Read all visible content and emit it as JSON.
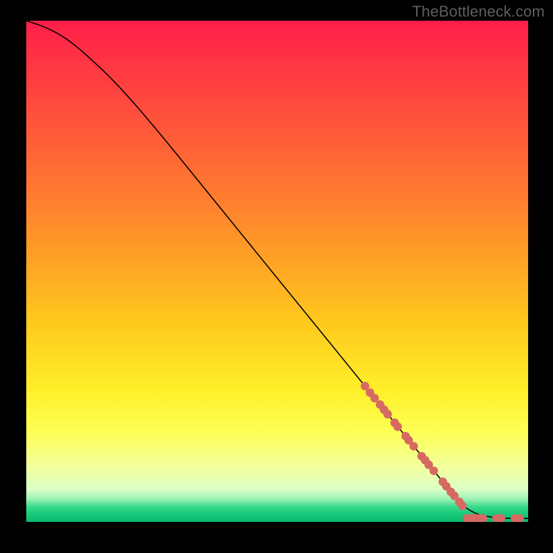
{
  "watermark": "TheBottleneck.com",
  "chart_data": {
    "type": "line",
    "title": "",
    "xlabel": "",
    "ylabel": "",
    "xlim": [
      0,
      100
    ],
    "ylim": [
      0,
      100
    ],
    "grid": false,
    "curve": {
      "x": [
        0,
        4,
        8,
        12,
        18,
        25,
        35,
        45,
        55,
        65,
        75,
        84,
        87,
        90,
        93,
        96,
        100
      ],
      "y": [
        100,
        98.7,
        96.5,
        93.2,
        87.5,
        79.5,
        67.2,
        54.8,
        42.5,
        30.2,
        17.8,
        6.8,
        3.1,
        1.4,
        0.9,
        0.7,
        0.7
      ]
    },
    "markers": [
      {
        "x": 67.5,
        "y": 27.1
      },
      {
        "x": 68.5,
        "y": 25.8
      },
      {
        "x": 69.4,
        "y": 24.7
      },
      {
        "x": 70.5,
        "y": 23.4
      },
      {
        "x": 71.3,
        "y": 22.4
      },
      {
        "x": 72.0,
        "y": 21.5
      },
      {
        "x": 73.4,
        "y": 19.8
      },
      {
        "x": 74.0,
        "y": 19.0
      },
      {
        "x": 75.6,
        "y": 17.1
      },
      {
        "x": 76.2,
        "y": 16.3
      },
      {
        "x": 77.2,
        "y": 15.1
      },
      {
        "x": 78.8,
        "y": 13.1
      },
      {
        "x": 79.5,
        "y": 12.3
      },
      {
        "x": 80.2,
        "y": 11.4
      },
      {
        "x": 81.2,
        "y": 10.2
      },
      {
        "x": 83.0,
        "y": 8.0
      },
      {
        "x": 83.7,
        "y": 7.1
      },
      {
        "x": 84.6,
        "y": 6.0
      },
      {
        "x": 85.3,
        "y": 5.2
      },
      {
        "x": 86.3,
        "y": 4.0
      },
      {
        "x": 86.9,
        "y": 3.2
      },
      {
        "x": 87.8,
        "y": 0.7
      },
      {
        "x": 88.4,
        "y": 0.7
      },
      {
        "x": 89.1,
        "y": 0.7
      },
      {
        "x": 89.7,
        "y": 0.7
      },
      {
        "x": 90.3,
        "y": 0.7
      },
      {
        "x": 91.0,
        "y": 0.7
      },
      {
        "x": 93.7,
        "y": 0.7
      },
      {
        "x": 94.6,
        "y": 0.7
      },
      {
        "x": 97.4,
        "y": 0.7
      },
      {
        "x": 98.3,
        "y": 0.7
      }
    ],
    "gradient_stops": [
      {
        "offset": 0.0,
        "color": "#ff1f49"
      },
      {
        "offset": 0.2,
        "color": "#ff533b"
      },
      {
        "offset": 0.4,
        "color": "#ff8a2b"
      },
      {
        "offset": 0.6,
        "color": "#ffc81d"
      },
      {
        "offset": 0.74,
        "color": "#fff02a"
      },
      {
        "offset": 0.82,
        "color": "#fdff55"
      },
      {
        "offset": 0.89,
        "color": "#f3ff9c"
      },
      {
        "offset": 0.935,
        "color": "#dcffc6"
      },
      {
        "offset": 0.955,
        "color": "#98f1b4"
      },
      {
        "offset": 0.97,
        "color": "#39d98a"
      },
      {
        "offset": 0.985,
        "color": "#16c97a"
      },
      {
        "offset": 1.0,
        "color": "#0ab86f"
      }
    ],
    "marker_color": "#d66a63",
    "line_color": "#000000"
  }
}
